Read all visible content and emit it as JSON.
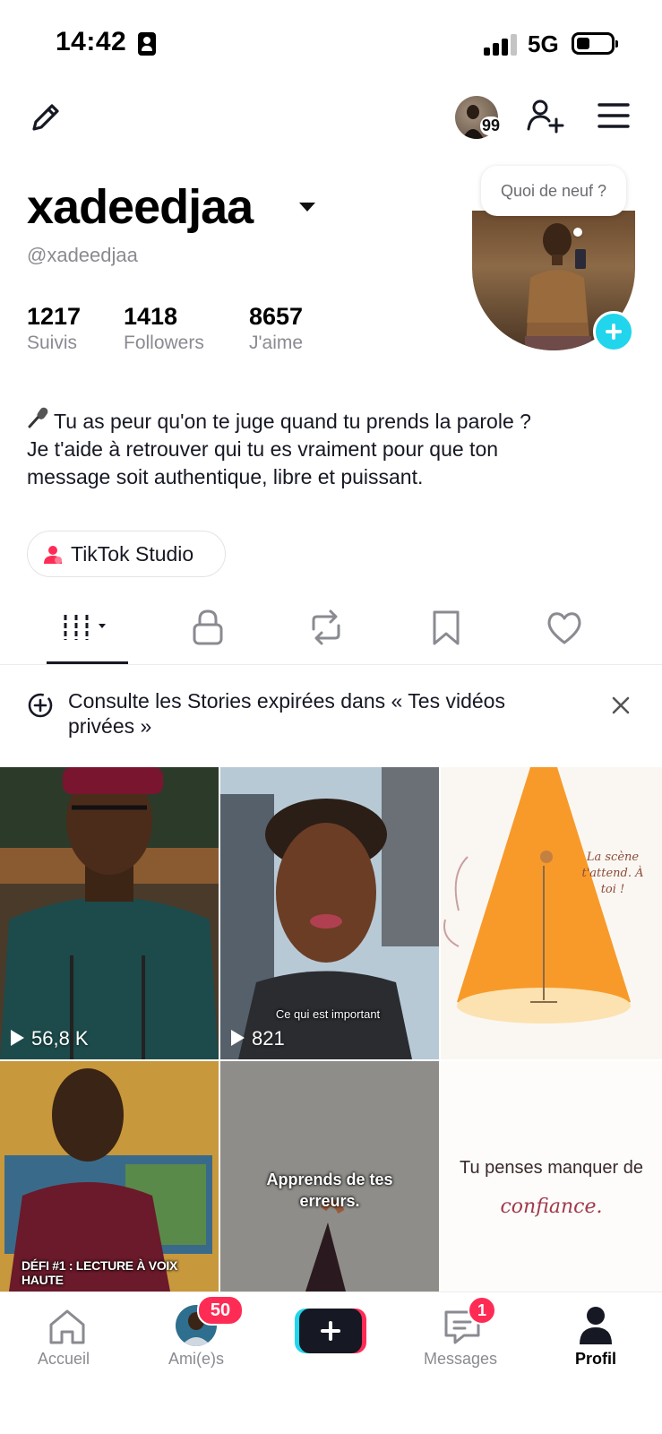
{
  "status_bar": {
    "time": "14:42",
    "network": "5G"
  },
  "top_bar": {
    "story_count": "99"
  },
  "profile": {
    "username": "xadeedjaa",
    "handle": "@xadeedjaa",
    "stats": [
      {
        "value": "1217",
        "label": "Suivis"
      },
      {
        "value": "1418",
        "label": "Followers"
      },
      {
        "value": "8657",
        "label": "J'aime"
      }
    ],
    "bubble_text": "Quoi de neuf ?",
    "bio_lines": [
      "Tu as peur qu'on te juge quand tu prends la parole ?",
      "Je t'aide à retrouver qui tu es vraiment pour que ton",
      "message soit authentique, libre et puissant."
    ]
  },
  "studio_button": {
    "label": "TikTok Studio"
  },
  "tabs": [
    {
      "icon": "videos-grid-icon"
    },
    {
      "icon": "lock-icon"
    },
    {
      "icon": "repost-icon"
    },
    {
      "icon": "bookmark-icon"
    },
    {
      "icon": "heart-icon"
    }
  ],
  "notice": {
    "text": "Consulte les Stories expirées dans « Tes vidéos privées »"
  },
  "videos": [
    {
      "views": "56,8 K",
      "caption": ""
    },
    {
      "views": "821",
      "caption": "Ce qui est important"
    },
    {
      "views": "",
      "caption": "La scène t'attend. À toi !"
    },
    {
      "views": "",
      "caption": "DÉFI #1 : LECTURE À VOIX HAUTE"
    },
    {
      "views": "",
      "caption": "Apprends de tes erreurs."
    },
    {
      "views": "",
      "caption": "Tu penses manquer de",
      "caption2": "confiance."
    }
  ],
  "bottom_nav": {
    "home": "Accueil",
    "friends": "Ami(e)s",
    "friends_badge": "50",
    "messages": "Messages",
    "messages_badge": "1",
    "profile": "Profil"
  },
  "colors": {
    "accent_cyan": "#20d5ec",
    "accent_red": "#fe2c55",
    "text_dark": "#161823",
    "text_gray": "#8a8b91"
  }
}
